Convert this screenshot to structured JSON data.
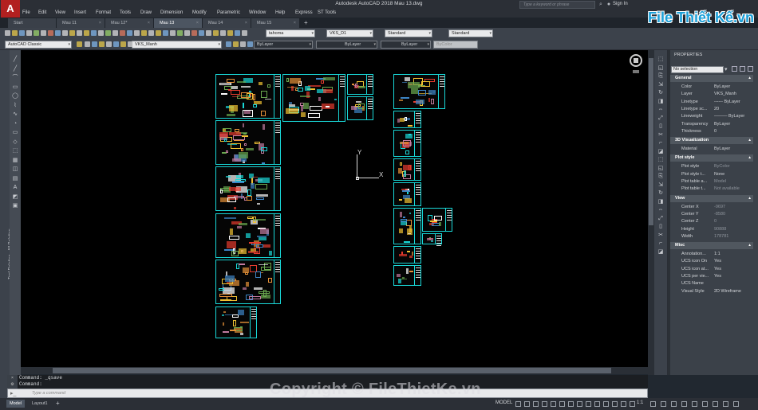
{
  "app": {
    "title": "Autodesk AutoCAD 2018    Mau 13.dwg",
    "logo": "A",
    "search_placeholder": "Type a keyword or phrase",
    "user": "Sign In"
  },
  "menu": [
    "File",
    "Edit",
    "View",
    "Insert",
    "Format",
    "Tools",
    "Draw",
    "Dimension",
    "Modify",
    "Parametric",
    "Window",
    "Help",
    "Express",
    "ST Tools"
  ],
  "tabs": [
    {
      "label": "Start",
      "active": false
    },
    {
      "label": "Mau 11",
      "active": false
    },
    {
      "label": "Mau 12*",
      "active": false
    },
    {
      "label": "Mau 13",
      "active": true
    },
    {
      "label": "Mau 14",
      "active": false
    },
    {
      "label": "Mau 15",
      "active": false
    }
  ],
  "toolbar": {
    "text_style": "tahoma",
    "dim_style": "VKS_D1",
    "table_style": "Standard",
    "mleader_style": "Standard",
    "workspace": "AutoCAD Classic",
    "layer": "VKS_Manh",
    "color": "ByLayer",
    "linetype": "ByLayer",
    "lineweight": "ByLayer",
    "plotstyle": "ByColor"
  },
  "left_palette_label": "Tool Palettes - All Palettes",
  "properties": {
    "title": "PROPERTIES",
    "selection": "No selection",
    "sections": [
      {
        "name": "General",
        "rows": [
          {
            "k": "Color",
            "v": "ByLayer"
          },
          {
            "k": "Layer",
            "v": "VKS_Manh"
          },
          {
            "k": "Linetype",
            "v": "------ ByLayer"
          },
          {
            "k": "Linetype sc...",
            "v": "20"
          },
          {
            "k": "Lineweight",
            "v": "——— ByLayer"
          },
          {
            "k": "Transparency",
            "v": "ByLayer"
          },
          {
            "k": "Thickness",
            "v": "0"
          }
        ]
      },
      {
        "name": "3D Visualization",
        "rows": [
          {
            "k": "Material",
            "v": "ByLayer"
          }
        ]
      },
      {
        "name": "Plot style",
        "rows": [
          {
            "k": "Plot style",
            "v": "ByColor",
            "muted": true
          },
          {
            "k": "Plot style t...",
            "v": "None"
          },
          {
            "k": "Plot table a...",
            "v": "Model",
            "muted": true
          },
          {
            "k": "Plot table t...",
            "v": "Not available",
            "muted": true
          }
        ]
      },
      {
        "name": "View",
        "rows": [
          {
            "k": "Center X",
            "v": "-9697",
            "muted": true
          },
          {
            "k": "Center Y",
            "v": "-8580",
            "muted": true
          },
          {
            "k": "Center Z",
            "v": "0",
            "muted": true
          },
          {
            "k": "Height",
            "v": "90888",
            "muted": true
          },
          {
            "k": "Width",
            "v": "178781",
            "muted": true
          }
        ]
      },
      {
        "name": "Misc",
        "rows": [
          {
            "k": "Annotation...",
            "v": "1:1"
          },
          {
            "k": "UCS icon On",
            "v": "Yes"
          },
          {
            "k": "UCS icon at...",
            "v": "Yes"
          },
          {
            "k": "UCS per vie...",
            "v": "Yes"
          },
          {
            "k": "UCS Name",
            "v": ""
          },
          {
            "k": "Visual Style",
            "v": "2D Wireframe"
          }
        ]
      }
    ]
  },
  "command": {
    "history": [
      "Command: _qsave",
      "Command:"
    ],
    "placeholder": "Type a command"
  },
  "status": {
    "layouts": [
      "Model",
      "Layout1"
    ],
    "mode": "MODEL",
    "scale": "1:1"
  },
  "ucs": {
    "x": "X",
    "y": "Y"
  },
  "watermark": "Copyright © FileThietKe.vn",
  "brand": "File Thiết Kế.vn"
}
